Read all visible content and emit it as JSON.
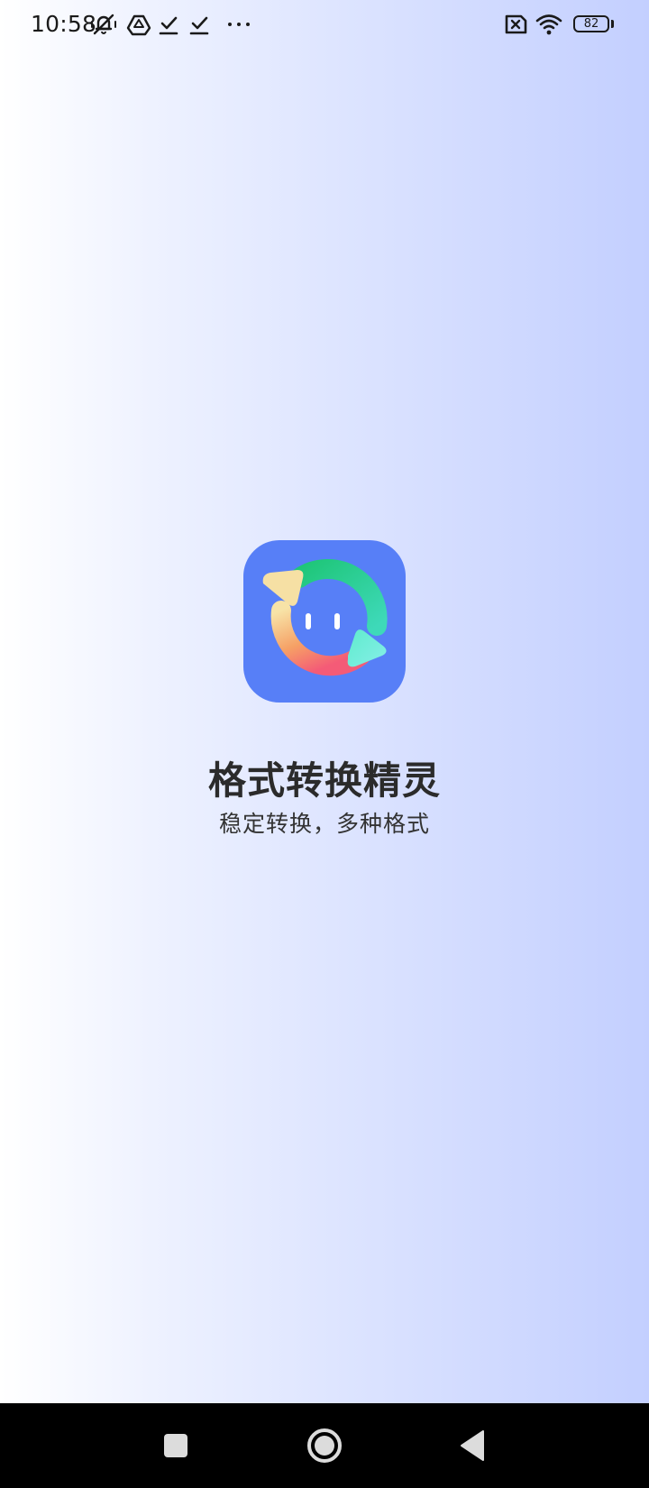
{
  "status_bar": {
    "time": "10:58",
    "battery_level": "82",
    "icons": [
      "mute-vibrate-icon",
      "drive-icon",
      "download-done-icon",
      "download-done-icon",
      "more-dots-icon",
      "no-sim-icon",
      "wifi-icon",
      "battery-icon"
    ]
  },
  "splash": {
    "app_name": "格式转换精灵",
    "slogan": "稳定转换，多种格式",
    "icon": "app-logo-icon",
    "icon_bg_color": "#577ff7"
  },
  "nav_bar": {
    "buttons": [
      "recents-square-icon",
      "home-circle-icon",
      "back-triangle-icon"
    ]
  },
  "colors": {
    "background_start": "#ffffff",
    "background_end": "#c3cfff",
    "text_primary": "#2b2b2b"
  }
}
